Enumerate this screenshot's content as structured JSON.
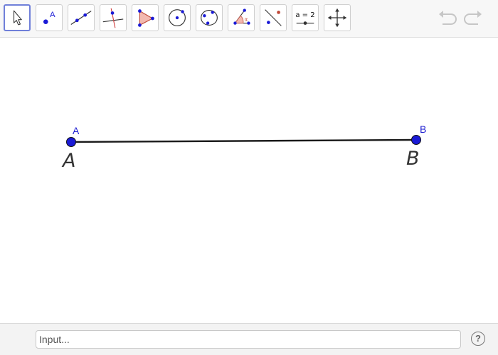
{
  "toolbar": {
    "tools": [
      {
        "name": "move-tool",
        "icon": "cursor-arrow-icon",
        "active": true
      },
      {
        "name": "point-tool",
        "icon": "point-icon",
        "label": "A"
      },
      {
        "name": "line-tool",
        "icon": "line-through-two-points-icon"
      },
      {
        "name": "perpendicular-line-tool",
        "icon": "perpendicular-line-icon"
      },
      {
        "name": "polygon-tool",
        "icon": "polygon-icon"
      },
      {
        "name": "circle-tool",
        "icon": "circle-center-point-icon"
      },
      {
        "name": "circle-three-points-tool",
        "icon": "circle-three-points-icon"
      },
      {
        "name": "angle-tool",
        "icon": "angle-icon"
      },
      {
        "name": "reflect-tool",
        "icon": "reflect-about-line-icon"
      },
      {
        "name": "slider-tool",
        "icon": "slider-icon",
        "label": "a = 2"
      },
      {
        "name": "move-graphics-view-tool",
        "icon": "move-graphics-view-icon"
      }
    ],
    "undo_icon": "undo-icon",
    "redo_icon": "redo-icon"
  },
  "canvas": {
    "points": [
      {
        "name": "A",
        "label": "A"
      },
      {
        "name": "B",
        "label": "B"
      }
    ],
    "handwritten_labels": [
      "A",
      "B"
    ],
    "colors": {
      "point": "#1a1ad6",
      "segment": "#1a1a1a",
      "label": "#1c1cd0"
    }
  },
  "input_bar": {
    "placeholder": "Input...",
    "help_label": "?"
  }
}
